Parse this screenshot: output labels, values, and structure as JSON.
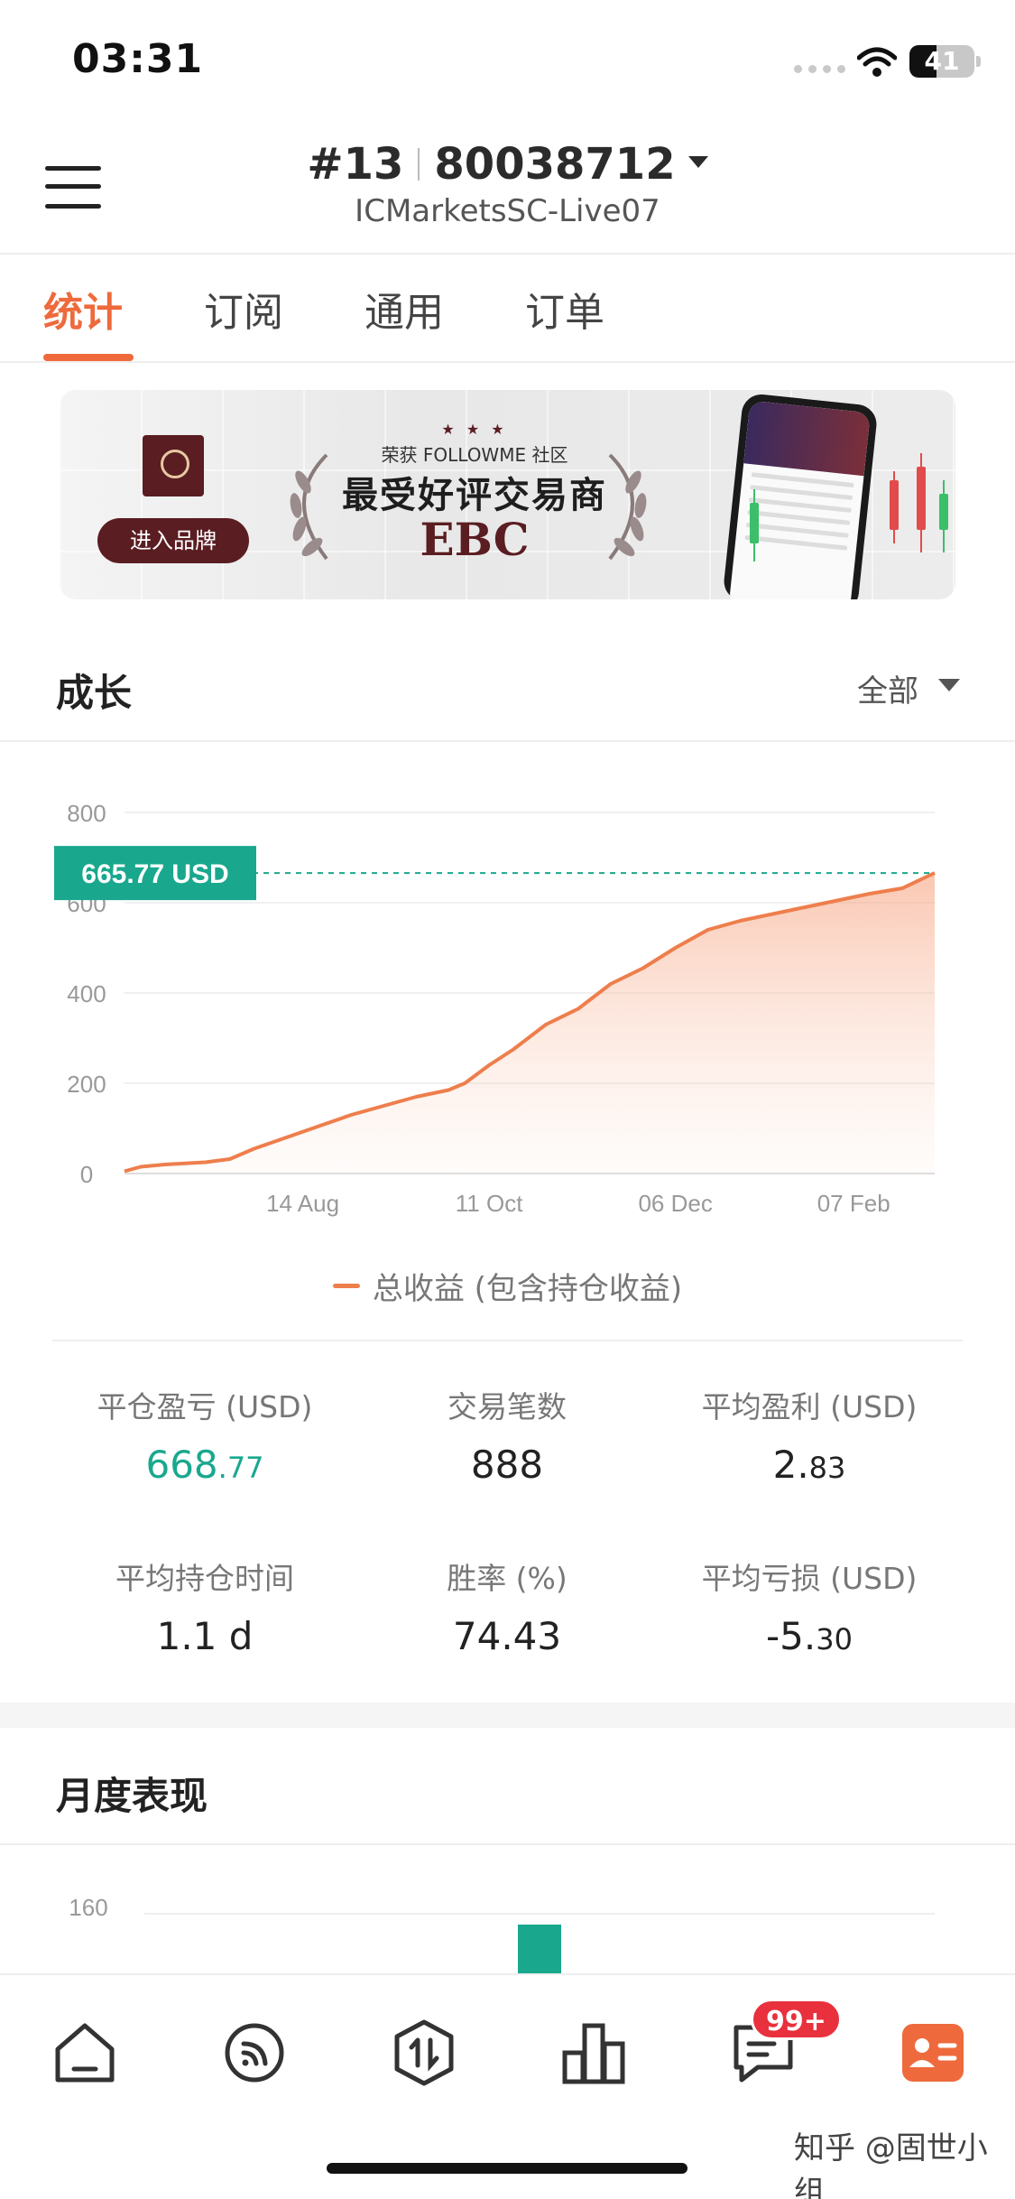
{
  "status_bar": {
    "time": "03:31",
    "battery": "41",
    "battery_level": 0.41
  },
  "header": {
    "account_number": "#13",
    "account_id": "80038712",
    "server": "ICMarketsSC-Live07"
  },
  "tabs": [
    {
      "label": "统计",
      "active": true
    },
    {
      "label": "订阅",
      "active": false
    },
    {
      "label": "通用",
      "active": false
    },
    {
      "label": "订单",
      "active": false
    }
  ],
  "banner": {
    "enter_button": "进入品牌",
    "award_line": "荣获 FOLLOWME 社区",
    "award_title": "最受好评交易商",
    "brand": "EBC"
  },
  "growth": {
    "title": "成长",
    "filter": "全部",
    "current_value_label": "665.77 USD",
    "legend": "总收益 (包含持仓收益)"
  },
  "chart_data": {
    "type": "area",
    "title": "",
    "xlabel": "",
    "ylabel": "",
    "ylim": [
      0,
      800
    ],
    "yticks": [
      "0",
      "200",
      "400",
      "600",
      "800"
    ],
    "xticks": [
      "14 Aug",
      "11 Oct",
      "06 Dec",
      "07 Feb"
    ],
    "xtick_positions": [
      0.22,
      0.45,
      0.68,
      0.9
    ],
    "series": [
      {
        "name": "总收益 (包含持仓收益)",
        "color": "#ee7e4c",
        "x": [
          0,
          0.02,
          0.05,
          0.1,
          0.13,
          0.16,
          0.2,
          0.24,
          0.28,
          0.32,
          0.36,
          0.4,
          0.42,
          0.45,
          0.48,
          0.52,
          0.56,
          0.6,
          0.64,
          0.68,
          0.72,
          0.76,
          0.8,
          0.84,
          0.88,
          0.92,
          0.96,
          1.0
        ],
        "y": [
          5,
          15,
          20,
          25,
          32,
          55,
          80,
          105,
          130,
          150,
          170,
          185,
          200,
          240,
          275,
          330,
          365,
          420,
          455,
          500,
          540,
          560,
          575,
          590,
          605,
          620,
          632,
          666
        ]
      }
    ],
    "current_value": 665.77,
    "grid": true
  },
  "stats": [
    {
      "label": "平仓盈亏 (USD)",
      "int": "668",
      "dec": ".77",
      "green": true
    },
    {
      "label": "交易笔数",
      "int": "888",
      "dec": "",
      "green": false
    },
    {
      "label": "平均盈利 (USD)",
      "int": "2.",
      "dec": "83",
      "green": false
    },
    {
      "label": "平均持仓时间",
      "int": "1.1 d",
      "dec": "",
      "green": false
    },
    {
      "label": "胜率 (%)",
      "int": "74.43",
      "dec": "",
      "green": false
    },
    {
      "label": "平均亏损 (USD)",
      "int": "-5.",
      "dec": "30",
      "green": false
    }
  ],
  "monthly": {
    "title": "月度表现",
    "ytick": "160",
    "bar_color": "#19a88d"
  },
  "bottom_nav": {
    "badge": "99+"
  },
  "watermark": "知乎 @固世小组",
  "colors": {
    "accent": "#ee6a3c",
    "positive": "#19a88d",
    "line": "#ee7e4c"
  }
}
